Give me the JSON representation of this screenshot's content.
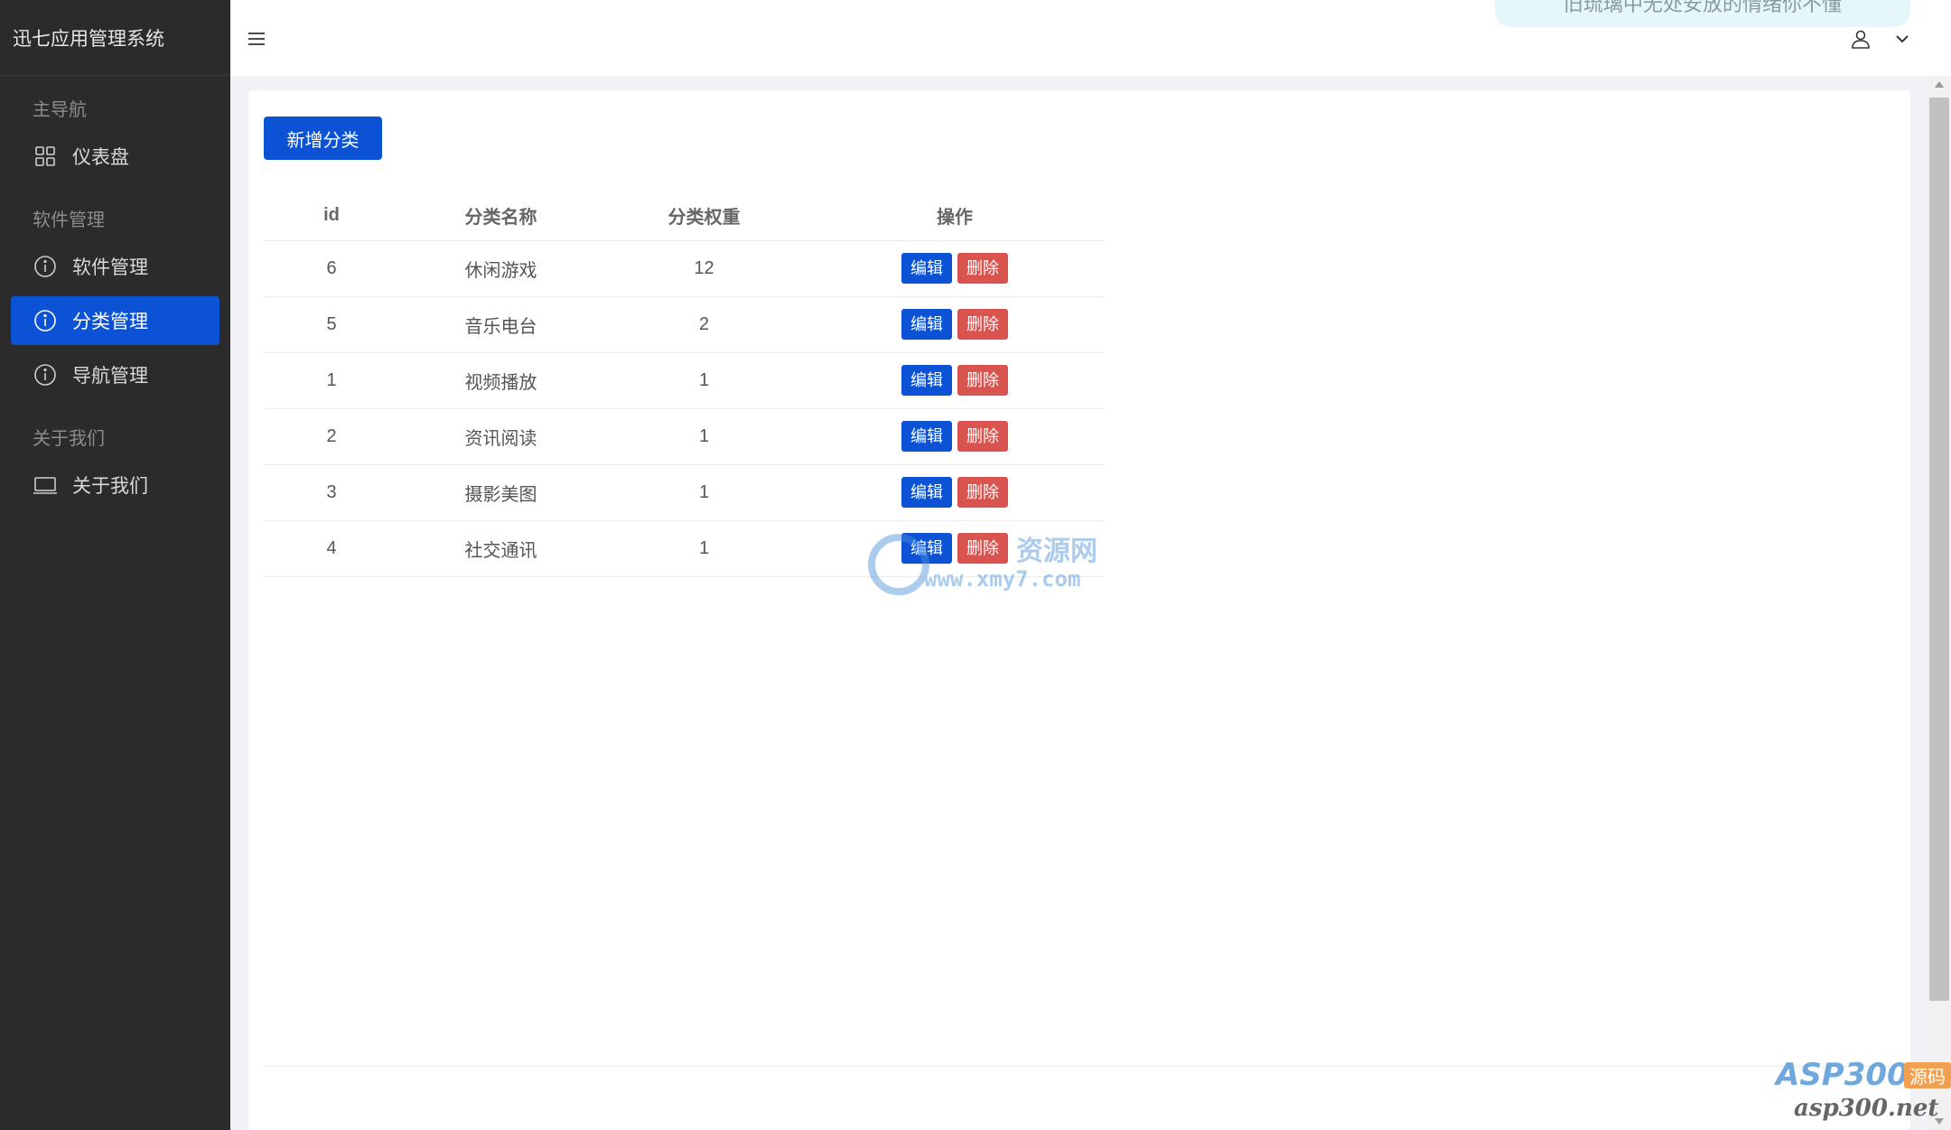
{
  "app": {
    "title": "迅七应用管理系统"
  },
  "sidebar": {
    "groups": [
      {
        "title": "主导航",
        "items": [
          {
            "label": "仪表盘",
            "icon": "dashboard-grid-icon"
          }
        ]
      },
      {
        "title": "软件管理",
        "items": [
          {
            "label": "软件管理",
            "icon": "info-circle-icon"
          },
          {
            "label": "分类管理",
            "icon": "info-circle-icon",
            "active": true
          },
          {
            "label": "导航管理",
            "icon": "info-circle-icon"
          }
        ]
      },
      {
        "title": "关于我们",
        "items": [
          {
            "label": "关于我们",
            "icon": "laptop-icon"
          }
        ]
      }
    ]
  },
  "header": {
    "menu_icon": "hamburger-menu-icon",
    "notice": "旧琉璃中无处安放的情绪你不懂",
    "user_icon": "user-icon",
    "caret_icon": "chevron-down-icon"
  },
  "main": {
    "add_button": "新增分类",
    "table": {
      "headers": {
        "id": "id",
        "name": "分类名称",
        "weight": "分类权重",
        "ops": "操作"
      },
      "rows": [
        {
          "id": "6",
          "name": "休闲游戏",
          "weight": "12"
        },
        {
          "id": "5",
          "name": "音乐电台",
          "weight": "2"
        },
        {
          "id": "1",
          "name": "视频播放",
          "weight": "1"
        },
        {
          "id": "2",
          "name": "资讯阅读",
          "weight": "1"
        },
        {
          "id": "3",
          "name": "摄影美图",
          "weight": "1"
        },
        {
          "id": "4",
          "name": "社交通讯",
          "weight": "1"
        }
      ],
      "edit_label": "编辑",
      "delete_label": "删除"
    }
  },
  "watermarks": {
    "center_cn": "资源网",
    "center_url": "www.xmy7.com",
    "corner_brand": "ASP300",
    "corner_tag": "源码",
    "corner_url": "asp300.net"
  },
  "colors": {
    "sidebar_bg": "#2b2b2b",
    "accent": "#0c52d4",
    "danger": "#d9534f"
  }
}
